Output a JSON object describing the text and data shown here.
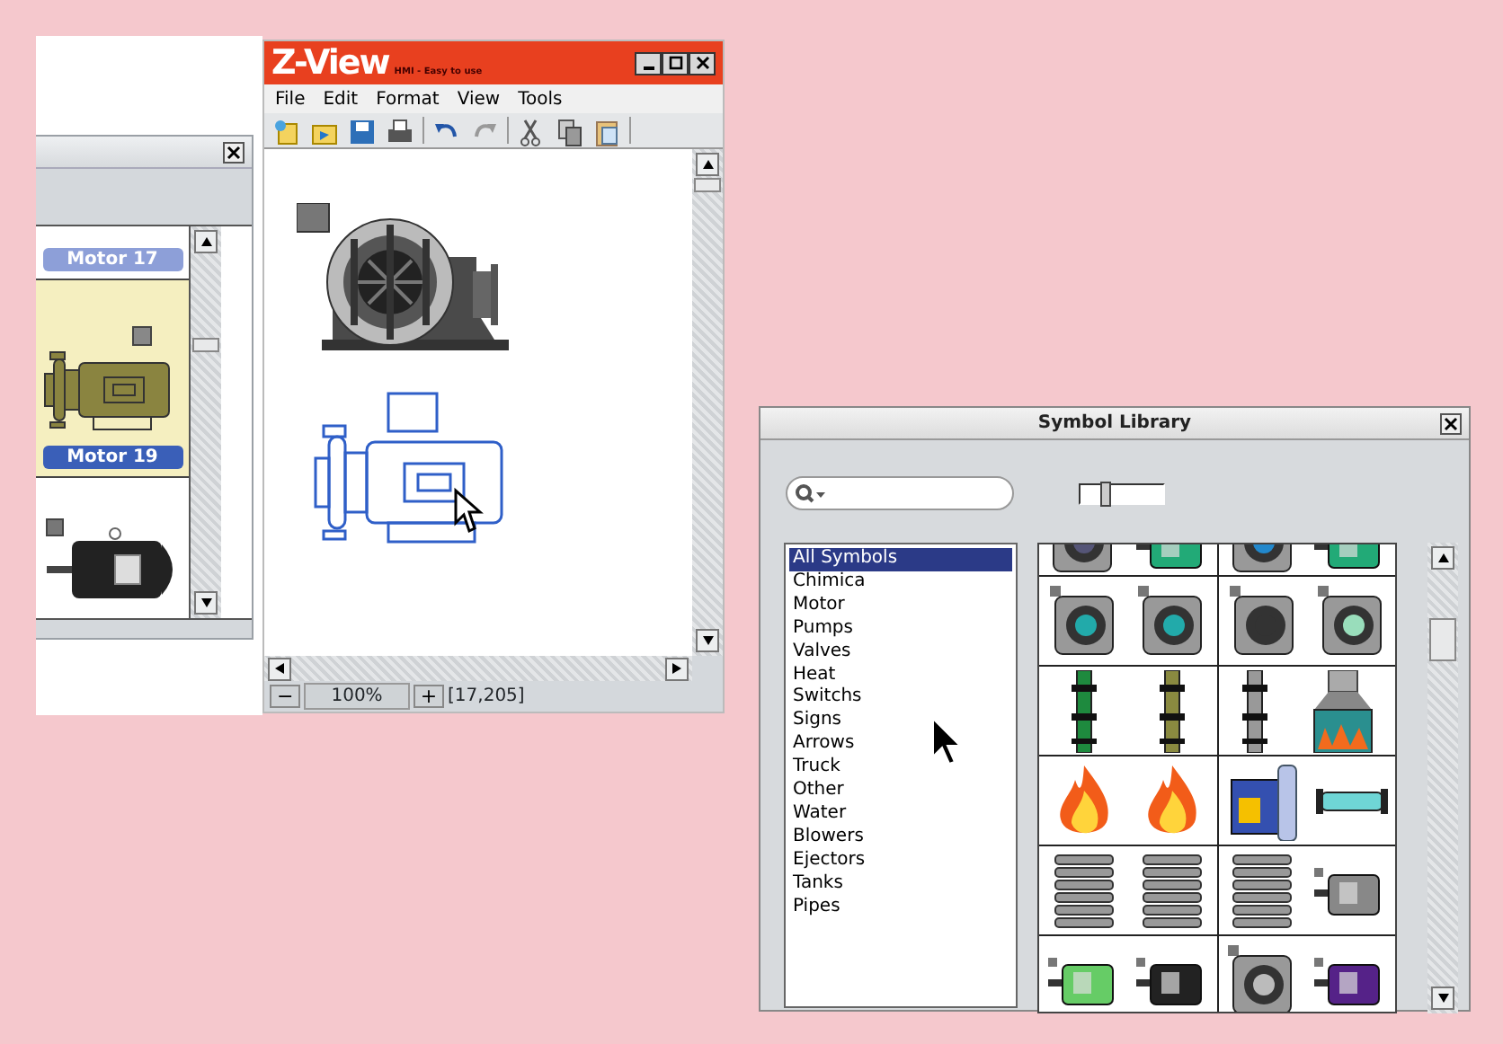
{
  "motor_panel": {
    "items": [
      {
        "label": "Motor 17",
        "selected": false
      },
      {
        "label": "Motor 19",
        "selected": true
      },
      {
        "selected": false
      }
    ]
  },
  "zview": {
    "title": "Z-View",
    "subtitle": "HMI - Easy to use",
    "menu": [
      "File",
      "Edit",
      "Format",
      "View",
      "Tools"
    ],
    "canvas_objects": [
      {
        "selected": false
      },
      {
        "selected": true
      }
    ],
    "status": {
      "zoom_out": "−",
      "zoom": "100%",
      "zoom_in": "+",
      "coordinates": "[17,205]"
    }
  },
  "symbol_library": {
    "title": "Symbol Library",
    "size_slider": {
      "level": 0.3
    },
    "categories": [
      {
        "label": "All Symbols",
        "selected": true
      },
      {
        "label": "Chimica",
        "selected": false
      },
      {
        "label": "Motor",
        "selected": false
      },
      {
        "label": "Pumps",
        "selected": false
      },
      {
        "label": "Valves",
        "selected": false
      },
      {
        "label": "Heat",
        "selected": false
      },
      {
        "label": "Switchs",
        "selected": false
      },
      {
        "label": "Signs",
        "selected": false
      },
      {
        "label": "Arrows",
        "selected": false
      },
      {
        "label": "Truck",
        "selected": false
      },
      {
        "label": "Other",
        "selected": false
      },
      {
        "label": "Water",
        "selected": false
      },
      {
        "label": "Blowers",
        "selected": false
      },
      {
        "label": "Ejectors",
        "selected": false
      },
      {
        "label": "Tanks",
        "selected": false
      },
      {
        "label": "Pipes",
        "selected": false
      }
    ]
  }
}
